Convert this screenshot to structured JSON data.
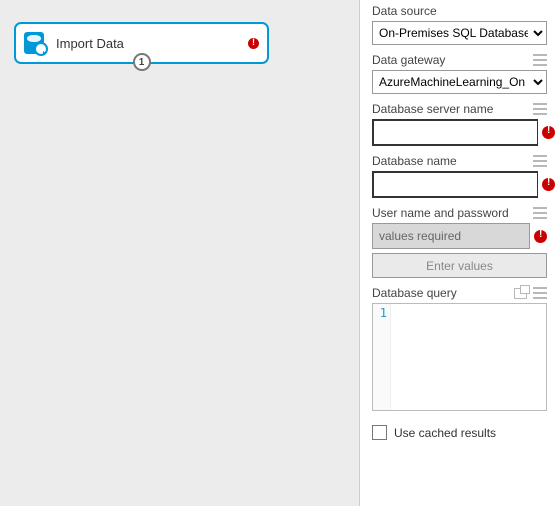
{
  "module": {
    "title": "Import Data",
    "port_number": "1",
    "has_error": true
  },
  "data_source": {
    "label": "Data source",
    "value": "On-Premises SQL Database"
  },
  "data_gateway": {
    "label": "Data gateway",
    "value": "AzureMachineLearning_On"
  },
  "server_name": {
    "label": "Database server name",
    "value": "",
    "error": true
  },
  "db_name": {
    "label": "Database name",
    "value": "",
    "error": true
  },
  "credentials": {
    "label": "User name and password",
    "placeholder": "values required",
    "button": "Enter values",
    "error": true
  },
  "db_query": {
    "label": "Database query",
    "line_number": "1",
    "value": ""
  },
  "cached": {
    "label": "Use cached results",
    "checked": false
  }
}
